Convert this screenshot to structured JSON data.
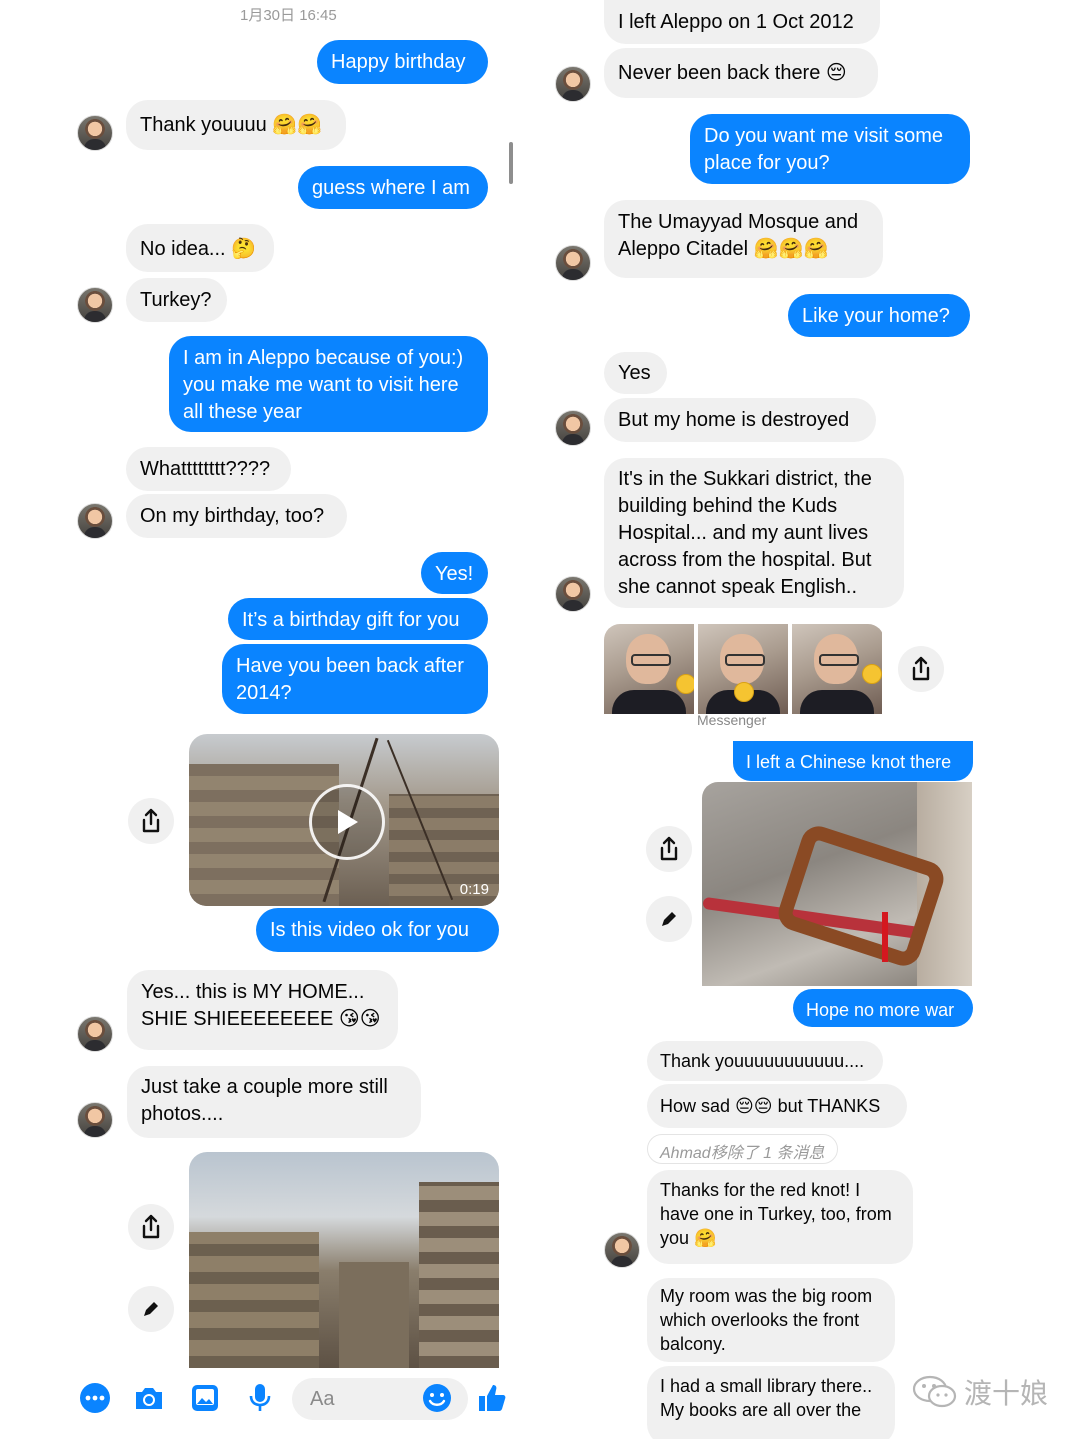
{
  "timestamp": "1月30日 16:45",
  "left_top": {
    "msgs": [
      {
        "text": "Happy birthday"
      },
      {
        "text": "Thank youuuu 🤗🤗"
      },
      {
        "text": "guess where I am"
      },
      {
        "text": "No idea... 🤔"
      },
      {
        "text": "Turkey?"
      },
      {
        "text": "I am in Aleppo because of you:) you make me want to visit here all these year"
      },
      {
        "text": "Whatttttttt????"
      },
      {
        "text": "On my birthday, too?"
      },
      {
        "text": "Yes!"
      },
      {
        "text": "It’s a birthday gift for you"
      },
      {
        "text": "Have you been back after 2014?"
      }
    ]
  },
  "right_top": {
    "msgs": [
      {
        "text": "I left Aleppo on 1 Oct 2012"
      },
      {
        "text": "Never been back there 😔"
      },
      {
        "text": "Do you want me visit some place for you?"
      },
      {
        "text": "The Umayyad Mosque and Aleppo Citadel 🤗🤗🤗"
      },
      {
        "text": "Like your home?"
      },
      {
        "text": "Yes"
      },
      {
        "text": "But my home is destroyed"
      },
      {
        "text": "It's in the Sukkari district, the building behind the Kuds Hospital... and my aunt lives across from the hospital. But she cannot speak English.."
      }
    ],
    "header_fragment": "Messenger"
  },
  "left_bottom": {
    "video_duration": "0:19",
    "msgs": [
      {
        "text": "Is this video ok for you"
      },
      {
        "text": "Yes... this is MY HOME... SHIE SHIEEEEEEEE 😘😘"
      },
      {
        "text": "Just take a couple more still photos...."
      }
    ],
    "composer_placeholder": "Aa"
  },
  "right_bottom": {
    "msgs": [
      {
        "text": "I left a Chinese knot there"
      },
      {
        "text": "Hope no more war"
      },
      {
        "text": "Thank youuuuuuuuuuu...."
      },
      {
        "text": "How sad 😔😔 but THANKS"
      },
      {
        "text": "Ahmad移除了 1 条消息"
      },
      {
        "text": "Thanks for the red knot! I have one in Turkey, too, from you 🤗"
      },
      {
        "text": "My room was the big room which overlooks the front balcony."
      },
      {
        "text": "I had a small library there.. My books are all over the"
      }
    ]
  },
  "watermark": "渡十娘",
  "colors": {
    "outgoing": "#0a84ff",
    "incoming": "#f0f0f0",
    "accent": "#0a84ff"
  },
  "icons": [
    "share-icon",
    "edit-icon",
    "more-icon",
    "camera-icon",
    "gallery-icon",
    "mic-icon",
    "emoji-icon",
    "like-icon",
    "play-icon"
  ]
}
